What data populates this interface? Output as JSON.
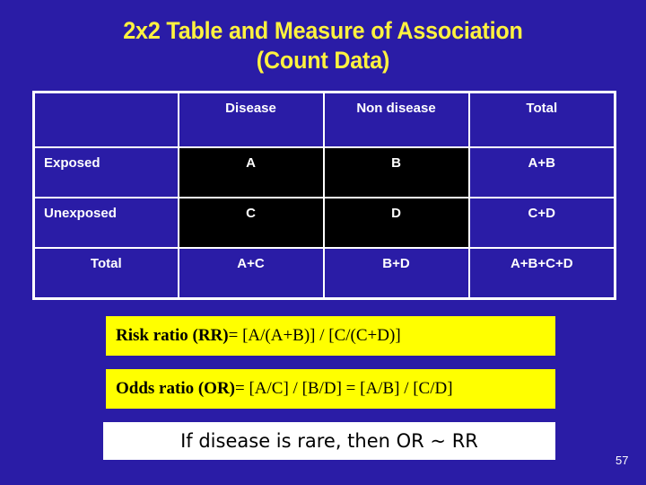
{
  "slide": {
    "background_color": "#2A1CA6",
    "title_color": "#FFF23F",
    "title_line_1": "2x2 Table and Measure of Association",
    "title_line_2": "(Count Data)",
    "page_number": "57"
  },
  "table": {
    "border_color": "#FFFFFF",
    "highlight_cell_color": "#000000",
    "columns": [
      "",
      "Disease",
      "Non disease",
      "Total"
    ],
    "rows": [
      {
        "label": "Exposed",
        "cells": [
          "A",
          "B",
          "A+B"
        ]
      },
      {
        "label": "Unexposed",
        "cells": [
          "C",
          "D",
          "C+D"
        ]
      },
      {
        "label": "Total",
        "cells": [
          "A+C",
          "B+D",
          "A+B+C+D"
        ]
      }
    ]
  },
  "formulas": {
    "box_color": "#FFFF00",
    "risk_ratio": {
      "name": "Risk ratio (RR) ",
      "expression": " = [A/(A+B)] / [C/(C+D)]"
    },
    "odds_ratio": {
      "name": "Odds ratio (OR)",
      "expression": " = [A/C] / [B/D] = [A/B] / [C/D]"
    }
  },
  "note": {
    "box_color": "#FFFFFF",
    "text": "If disease is rare, then OR ~ RR"
  }
}
